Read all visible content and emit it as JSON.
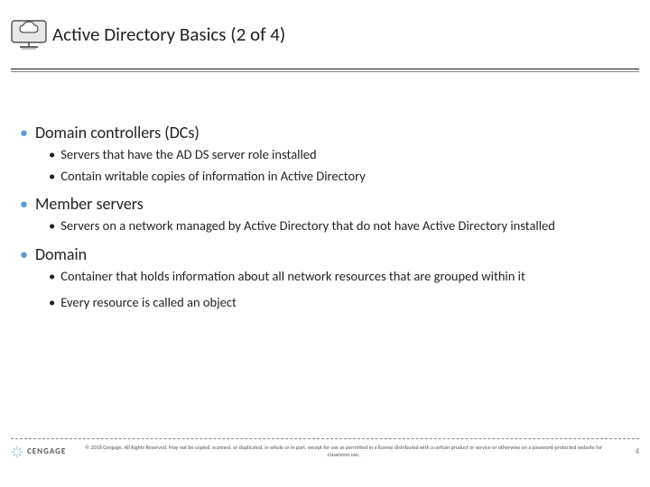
{
  "title": "Active Directory Basics (2 of 4)",
  "sections": [
    {
      "heading": "Domain controllers (DCs)",
      "items": [
        "Servers that have the AD DS server role installed",
        "Contain writable copies of information in Active Directory"
      ]
    },
    {
      "heading": "Member servers",
      "items": [
        "Servers on a network managed by Active Directory that do not have Active Directory installed"
      ]
    },
    {
      "heading": "Domain",
      "items": [
        "Container that holds information about all network resources that are grouped within it",
        "Every resource is called an object"
      ]
    }
  ],
  "footer": {
    "brand": "CENGAGE",
    "copyright": "© 2018 Cengage. All Rights Reserved. May not be copied, scanned, or duplicated, in whole or in part, except for use as permitted in a license distributed with a certain product or service or otherwise on a password-protected website for classroom use.",
    "page": "4"
  }
}
